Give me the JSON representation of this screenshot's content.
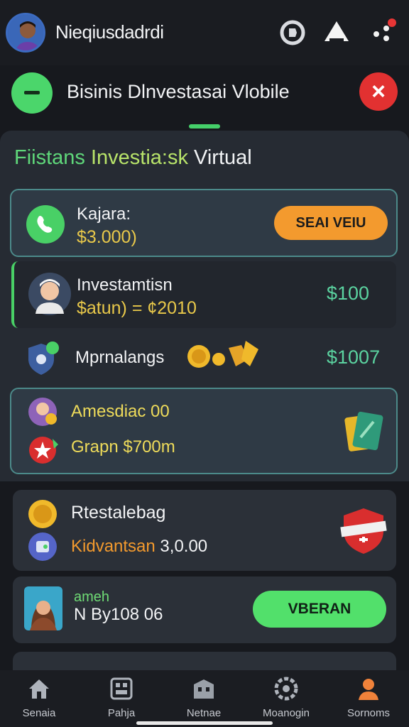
{
  "app": {
    "title": "Nieqiusdadrdi"
  },
  "header": {
    "title": "Bisinis Dlnvestasai Vlobile",
    "close_icon": "×"
  },
  "section": {
    "title_part1": "Fiistans",
    "title_part2": "Investia:sk",
    "title_part3": "Virtual"
  },
  "cards": {
    "balance": {
      "label": "Kajara:",
      "value": "$3.000)",
      "button": "SEAI VEIU"
    },
    "investment": {
      "title": "Investamtisn",
      "sub": "$atun) = ¢2010",
      "amount": "$100"
    },
    "upgrades": {
      "title": "Mprnalangs",
      "amount": "$1007"
    },
    "group": {
      "line1": "Amesdiac 00",
      "line2": "Grapn $700m"
    },
    "fastest": {
      "title": "Rtestalebag",
      "sub_orange": "Kidvantsan",
      "sub_white": "3,0.00"
    },
    "profile": {
      "label_green": "ameh",
      "label_white": "N By108 06",
      "button": "VBERAN"
    }
  },
  "nav": [
    {
      "label": "Senaia",
      "icon": "home-icon"
    },
    {
      "label": "Pahja",
      "icon": "grid-icon"
    },
    {
      "label": "Netnae",
      "icon": "building-icon"
    },
    {
      "label": "Moanogin",
      "icon": "gear-icon"
    },
    {
      "label": "Sornoms",
      "icon": "user-icon"
    }
  ],
  "colors": {
    "accent_green": "#4bd66b",
    "accent_orange": "#f39a2e",
    "danger": "#e23131"
  }
}
